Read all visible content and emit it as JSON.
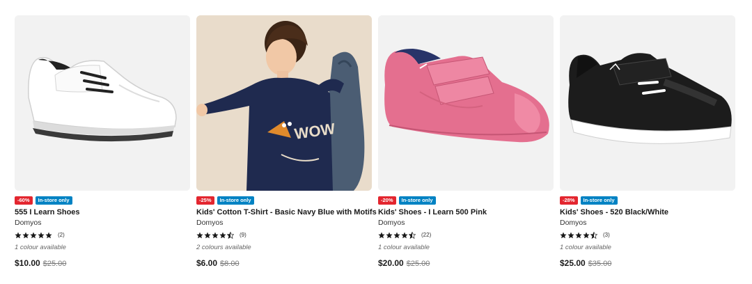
{
  "products": [
    {
      "discount": "-60%",
      "availability": "In-store only",
      "name": "555 I Learn Shoes",
      "brand": "Domyos",
      "rating": 5,
      "review_count": "(2)",
      "colours": "1 colour available",
      "price": "$10.00",
      "old_price": "$25.00",
      "image": "white-kids-shoe"
    },
    {
      "discount": "-25%",
      "availability": "In-store only",
      "name": "Kids' Cotton T-Shirt - Basic Navy Blue with Motifs",
      "brand": "Domyos",
      "rating": 4.5,
      "review_count": "(9)",
      "colours": "2 colours available",
      "price": "$6.00",
      "old_price": "$8.00",
      "image": "child-in-navy-tshirt",
      "image_text": "WOW"
    },
    {
      "discount": "-20%",
      "availability": "In-store only",
      "name": "Kids' Shoes - I Learn 500 Pink",
      "brand": "Domyos",
      "rating": 4.5,
      "review_count": "(22)",
      "colours": "1 colour available",
      "price": "$20.00",
      "old_price": "$25.00",
      "image": "pink-kids-shoe"
    },
    {
      "discount": "-28%",
      "availability": "In-store only",
      "name": "Kids' Shoes - 520 Black/White",
      "brand": "Domyos",
      "rating": 4.5,
      "review_count": "(3)",
      "colours": "1 colour available",
      "price": "$25.00",
      "old_price": "$35.00",
      "image": "black-kids-shoe"
    }
  ],
  "colors": {
    "discount_badge": "#e3262f",
    "store_badge": "#0082c3",
    "star": "#1a1a1a"
  }
}
